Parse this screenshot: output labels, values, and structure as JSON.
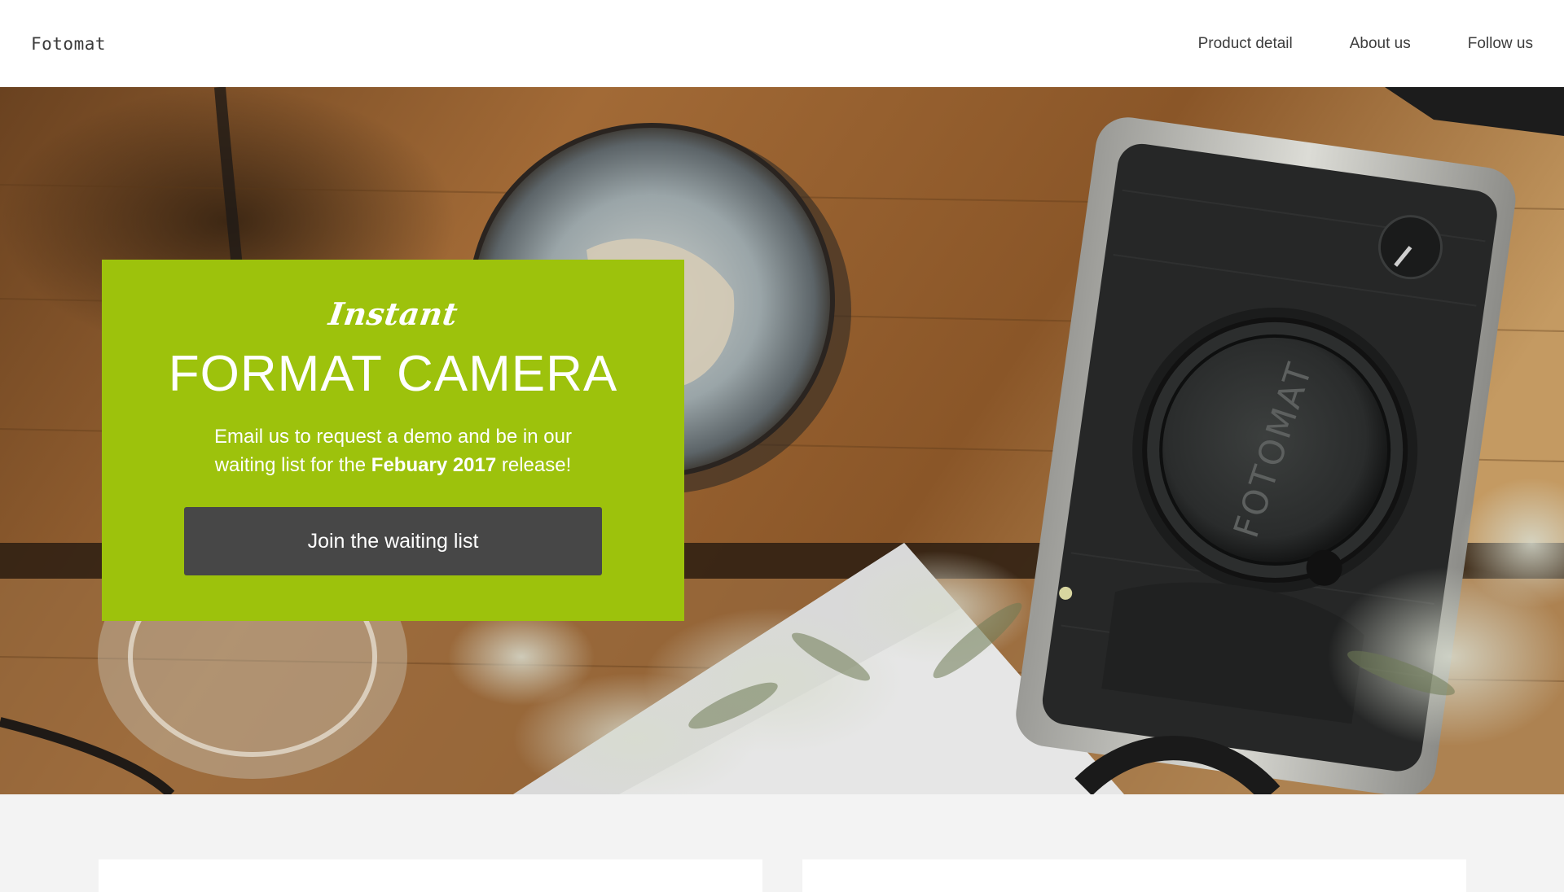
{
  "header": {
    "brand": "Fotomat",
    "nav": [
      {
        "label": "Product detail"
      },
      {
        "label": "About us"
      },
      {
        "label": "Follow us"
      }
    ]
  },
  "hero": {
    "camera_brand_text": "FOTOMAT",
    "promo": {
      "eyebrow": "Instant",
      "title": "FORMAT CAMERA",
      "text_before": "Email us to request a demo and be in our waiting list for the ",
      "text_strong": "Febuary 2017",
      "text_after": " release!",
      "cta_label": "Join the waiting list"
    }
  },
  "colors": {
    "accent": "#9dc20c",
    "button": "#474747",
    "header_bg": "#ffffff",
    "page_bg": "#f3f3f3"
  }
}
